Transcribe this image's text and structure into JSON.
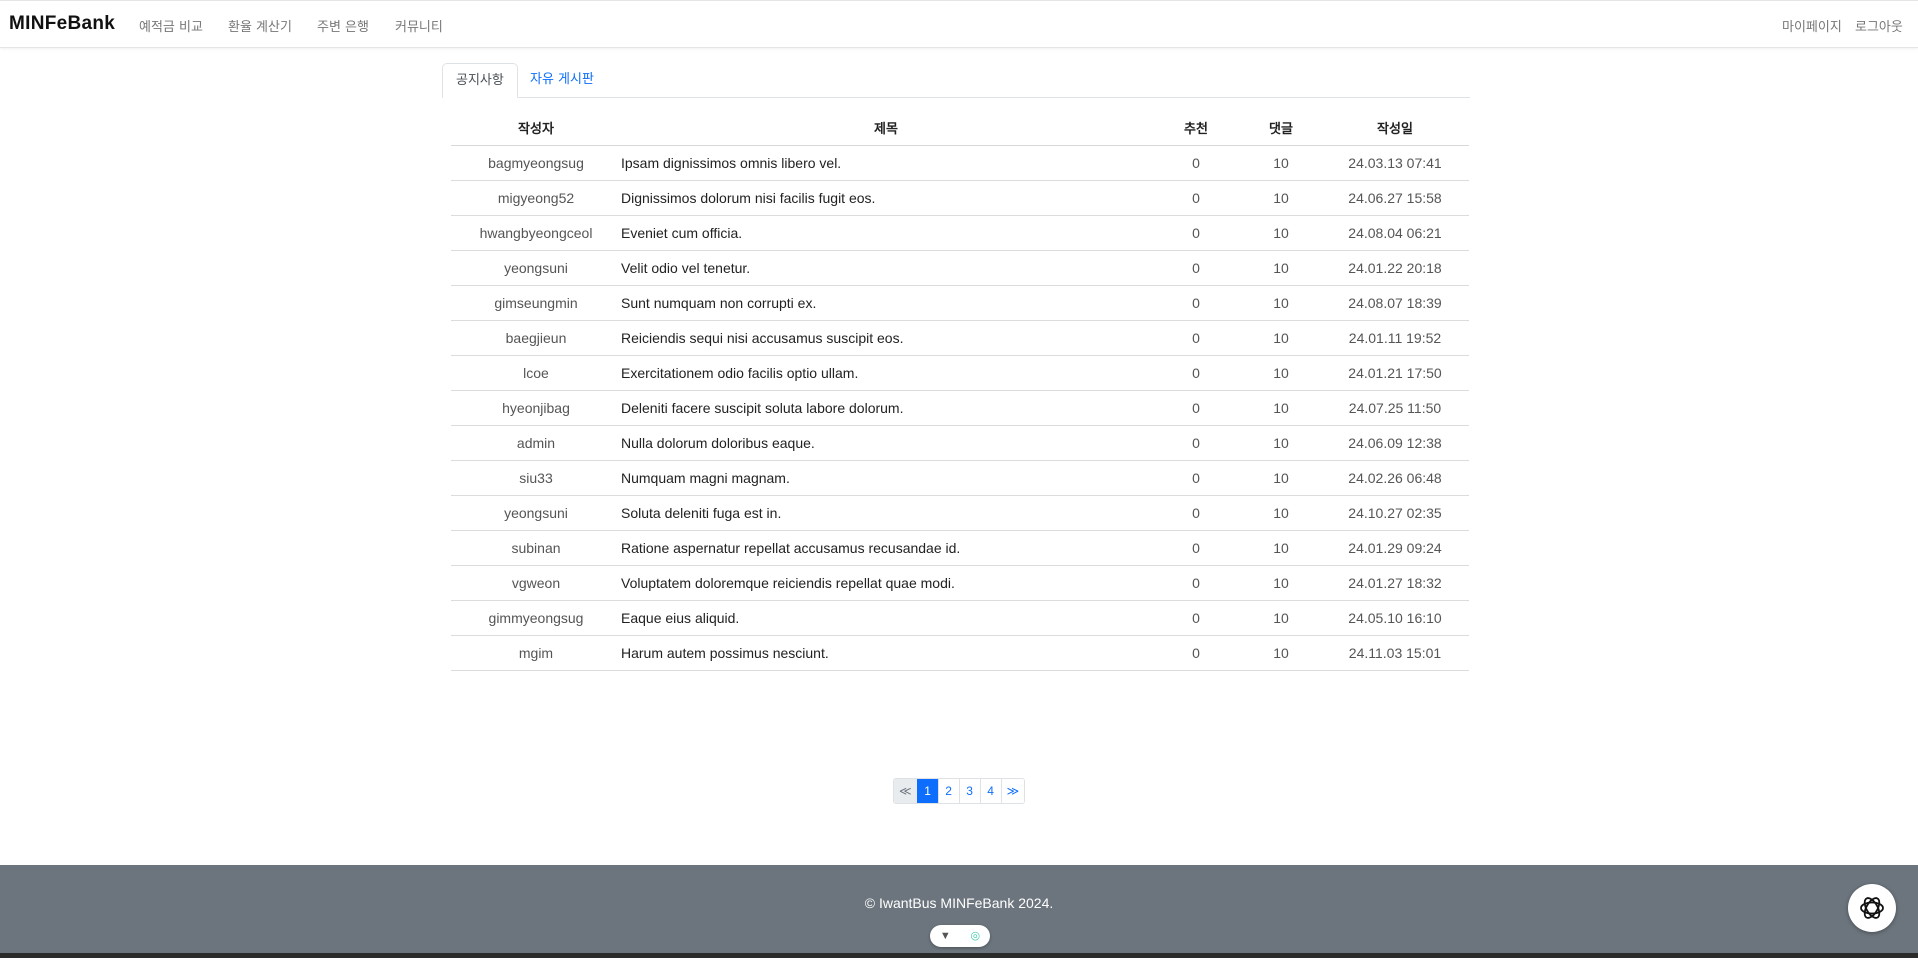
{
  "nav": {
    "brand": "MINFeBank",
    "links": [
      "예적금 비교",
      "환율 계산기",
      "주변 은행",
      "커뮤니티"
    ],
    "right": [
      "마이페이지",
      "로그아웃"
    ]
  },
  "tabs": [
    "공지사항",
    "자유 게시판"
  ],
  "table": {
    "headers": [
      "작성자",
      "제목",
      "추천",
      "댓글",
      "작성일"
    ],
    "rows": [
      [
        "bagmyeongsug",
        "Ipsam dignissimos omnis libero vel.",
        "0",
        "10",
        "24.03.13 07:41"
      ],
      [
        "migyeong52",
        "Dignissimos dolorum nisi facilis fugit eos.",
        "0",
        "10",
        "24.06.27 15:58"
      ],
      [
        "hwangbyeongceol",
        "Eveniet cum officia.",
        "0",
        "10",
        "24.08.04 06:21"
      ],
      [
        "yeongsuni",
        "Velit odio vel tenetur.",
        "0",
        "10",
        "24.01.22 20:18"
      ],
      [
        "gimseungmin",
        "Sunt numquam non corrupti ex.",
        "0",
        "10",
        "24.08.07 18:39"
      ],
      [
        "baegjieun",
        "Reiciendis sequi nisi accusamus suscipit eos.",
        "0",
        "10",
        "24.01.11 19:52"
      ],
      [
        "lcoe",
        "Exercitationem odio facilis optio ullam.",
        "0",
        "10",
        "24.01.21 17:50"
      ],
      [
        "hyeonjibag",
        "Deleniti facere suscipit soluta labore dolorum.",
        "0",
        "10",
        "24.07.25 11:50"
      ],
      [
        "admin",
        "Nulla dolorum doloribus eaque.",
        "0",
        "10",
        "24.06.09 12:38"
      ],
      [
        "siu33",
        "Numquam magni magnam.",
        "0",
        "10",
        "24.02.26 06:48"
      ],
      [
        "yeongsuni",
        "Soluta deleniti fuga est in.",
        "0",
        "10",
        "24.10.27 02:35"
      ],
      [
        "subinan",
        "Ratione aspernatur repellat accusamus recusandae id.",
        "0",
        "10",
        "24.01.29 09:24"
      ],
      [
        "vgweon",
        "Voluptatem doloremque reiciendis repellat quae modi.",
        "0",
        "10",
        "24.01.27 18:32"
      ],
      [
        "gimmyeongsug",
        "Eaque eius aliquid.",
        "0",
        "10",
        "24.05.10 16:10"
      ],
      [
        "mgim",
        "Harum autem possimus nesciunt.",
        "0",
        "10",
        "24.11.03 15:01"
      ]
    ]
  },
  "pagination": {
    "prev": "≪",
    "pages": [
      "1",
      "2",
      "3",
      "4"
    ],
    "next": "≫",
    "current": "1"
  },
  "footer": {
    "text": "© IwantBus MINFeBank 2024."
  },
  "icons": {
    "extension_left": "filter-icon",
    "extension_right": "target-icon",
    "assistant": "openai-logo-icon"
  },
  "colors": {
    "accent": "#0d6efd",
    "footer_bg": "#6c757d"
  }
}
